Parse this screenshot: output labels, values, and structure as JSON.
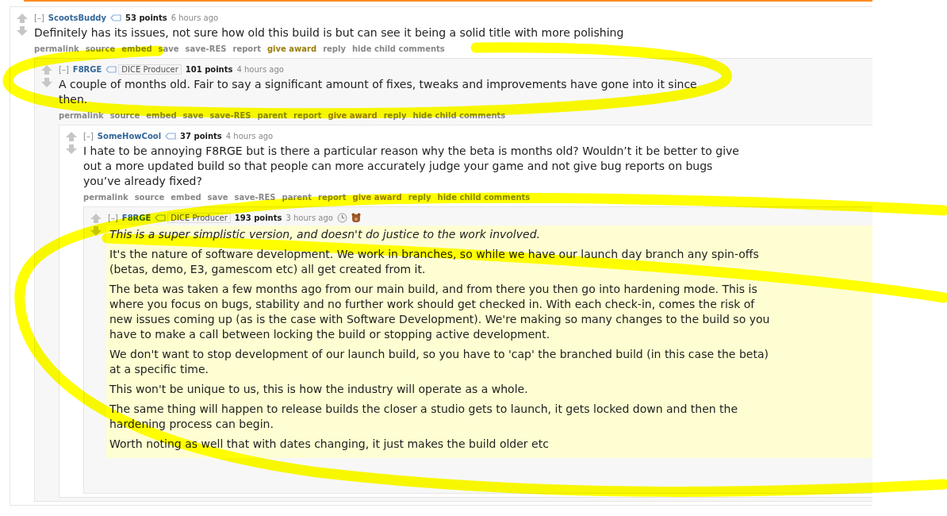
{
  "comments": [
    {
      "collapse": "[–]",
      "author": "ScootsBuddy",
      "score": "53 points",
      "time": "6 hours ago",
      "highlighted": false,
      "paragraphs": [
        {
          "text": "Definitely has its issues, not sure how old this build is but can see it being a solid title with more polishing",
          "italic": false
        }
      ],
      "links": [
        {
          "label": "permalink",
          "kind": "plain"
        },
        {
          "label": "source",
          "kind": "plain"
        },
        {
          "label": "embed",
          "kind": "plain"
        },
        {
          "label": "save",
          "kind": "plain"
        },
        {
          "label": "save-RES",
          "kind": "plain"
        },
        {
          "label": "report",
          "kind": "plain"
        },
        {
          "label": "give award",
          "kind": "award"
        },
        {
          "label": "reply",
          "kind": "plain"
        },
        {
          "label": "hide child comments",
          "kind": "plain"
        }
      ],
      "children": [
        {
          "collapse": "[–]",
          "author": "F8RGE",
          "flair": "DICE Producer",
          "score": "101 points",
          "time": "4 hours ago",
          "highlighted": false,
          "paragraphs": [
            {
              "text": "A couple of months old. Fair to say a significant amount of fixes, tweaks and improvements have gone into it since then.",
              "italic": false
            }
          ],
          "links": [
            {
              "label": "permalink",
              "kind": "plain"
            },
            {
              "label": "source",
              "kind": "plain"
            },
            {
              "label": "embed",
              "kind": "plain"
            },
            {
              "label": "save",
              "kind": "plain"
            },
            {
              "label": "save-RES",
              "kind": "plain"
            },
            {
              "label": "parent",
              "kind": "plain"
            },
            {
              "label": "report",
              "kind": "plain"
            },
            {
              "label": "give award",
              "kind": "award"
            },
            {
              "label": "reply",
              "kind": "plain"
            },
            {
              "label": "hide child comments",
              "kind": "plain"
            }
          ],
          "children": [
            {
              "collapse": "[–]",
              "author": "SomeHowCool",
              "score": "37 points",
              "time": "4 hours ago",
              "highlighted": false,
              "paragraphs": [
                {
                  "text": "I hate to be annoying F8RGE but is there a particular reason why the beta is months old? Wouldn’t it be better to give out a more updated build so that people can more accurately judge your game and not give bug reports on bugs you’ve already fixed?",
                  "italic": false
                }
              ],
              "links": [
                {
                  "label": "permalink",
                  "kind": "plain"
                },
                {
                  "label": "source",
                  "kind": "plain"
                },
                {
                  "label": "embed",
                  "kind": "plain"
                },
                {
                  "label": "save",
                  "kind": "plain"
                },
                {
                  "label": "save-RES",
                  "kind": "plain"
                },
                {
                  "label": "parent",
                  "kind": "plain"
                },
                {
                  "label": "report",
                  "kind": "plain"
                },
                {
                  "label": "give award",
                  "kind": "award"
                },
                {
                  "label": "reply",
                  "kind": "plain"
                },
                {
                  "label": "hide child comments",
                  "kind": "plain"
                }
              ],
              "children": [
                {
                  "collapse": "[–]",
                  "author": "F8RGE",
                  "flair": "DICE Producer",
                  "score": "193 points",
                  "time": "3 hours ago",
                  "awards": [
                    {
                      "kind": "silver"
                    },
                    {
                      "kind": "bear"
                    }
                  ],
                  "highlighted": true,
                  "paragraphs": [
                    {
                      "text": "This is a super simplistic version, and doesn't do justice to the work involved.",
                      "italic": true
                    },
                    {
                      "text": "It's the nature of software development. We work in branches, so while we have our launch day branch any spin-offs (betas, demo, E3, gamescom etc) all get created from it.",
                      "italic": false
                    },
                    {
                      "text": "The beta was taken a few months ago from our main build, and from there you then go into hardening mode. This is where you focus on bugs, stability and no further work should get checked in. With each check-in, comes the risk of new issues coming up (as is the case with Software Development). We're making so many changes to the build so you have to make a call between locking the build or stopping active development.",
                      "italic": false
                    },
                    {
                      "text": "We don't want to stop development of our launch build, so you have to 'cap' the branched build (in this case the beta) at a specific time.",
                      "italic": false
                    },
                    {
                      "text": "This won't be unique to us, this is how the industry will operate as a whole.",
                      "italic": false
                    },
                    {
                      "text": "The same thing will happen to release builds the closer a studio gets to launch, it gets locked down and then the hardening process can begin.",
                      "italic": false
                    },
                    {
                      "text": "Worth noting as well that with dates changing, it just makes the build older etc",
                      "italic": false
                    }
                  ]
                }
              ]
            }
          ]
        }
      ]
    }
  ]
}
